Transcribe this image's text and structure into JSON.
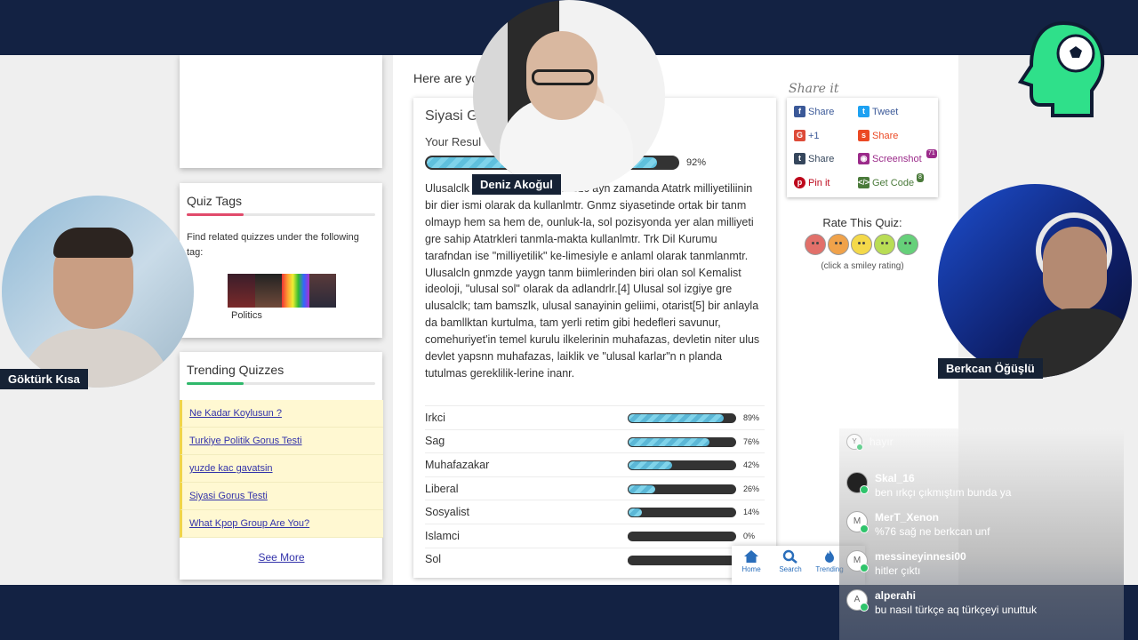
{
  "quiz_tags": {
    "title": "Quiz Tags",
    "description": "Find related quizzes under the following tag:",
    "tag_label": "Politics"
  },
  "trending": {
    "title": "Trending Quizzes",
    "items": [
      "Ne Kadar Koylusun ?",
      "Turkiye Politik Gorus Testi",
      "yuzde kac gavatsin",
      "Siyasi Gorus Testi",
      "What Kpop Group Are You?"
    ],
    "see_more": "See More"
  },
  "main": {
    "intro": "Here are yo",
    "result_title": "Siyasi G",
    "your_result_label": "Your Resul",
    "result_percent": 92,
    "result_percent_text": "92%",
    "result_text": "Ulusalclk                                   ideolojidir. Ulusalclk szc ayn zamanda Atatrk milliyetiliinin bir dier ismi olarak da kullanlmtr. Gnmz siyasetinde ortak bir tanm olmayp hem sa hem de, ounluk-la, sol pozisyonda yer alan milliyeti gre sahip Atatrkleri tanmla-makta kullanlmtr. Trk Dil Kurumu tarafndan ise \"milliyetilik\" ke-limesiyle e anlaml olarak tanmlanmtr. Ulusalcln gnmzde yaygn tanm biimlerinden biri olan sol Kemalist ideoloji, \"ulusal sol\" olarak da adlandrlr.[4] Ulusal sol izgiye gre ulusalclk; tam bamszlk, ulusal sanayinin geliimi, otarist[5] bir anlayla da bamllktan kurtulma, tam yerli retim gibi hedefleri savunur, comehuriyet'in temel kurulu ilkelerinin muhafazas, devletin niter ulus devlet yapsnn muhafazas, laiklik ve \"ulusal karlar\"n n planda tutulmas gereklilik-lerine inanr.",
    "scores": [
      {
        "label": "Irkci",
        "value": 89,
        "text": "89%"
      },
      {
        "label": "Sag",
        "value": 76,
        "text": "76%"
      },
      {
        "label": "Muhafazakar",
        "value": 42,
        "text": "42%"
      },
      {
        "label": "Liberal",
        "value": 26,
        "text": "26%"
      },
      {
        "label": "Sosyalist",
        "value": 14,
        "text": "14%"
      },
      {
        "label": "Islamci",
        "value": 0,
        "text": "0%"
      },
      {
        "label": "Sol",
        "value": 0,
        "text": ""
      }
    ]
  },
  "share": {
    "title": "Share it",
    "buttons": [
      "Share",
      "Tweet",
      "+1",
      "Share",
      "Share",
      "Screenshot",
      "Pin it",
      "Get Code"
    ],
    "screenshot_count": "71",
    "code_count": "8"
  },
  "rate": {
    "title": "Rate This Quiz:",
    "hint": "(click a smiley rating)",
    "colors": [
      "#e2706a",
      "#f0a24a",
      "#f4d94a",
      "#b9dd55",
      "#66d07a"
    ]
  },
  "mini_nav": {
    "home": "Home",
    "search": "Search",
    "trending": "Trending"
  },
  "streamers": {
    "top": "Deniz Akoğul",
    "left": "Göktürk Kısa",
    "right": "Berkcan Öğüşlü"
  },
  "chat": {
    "messages": [
      {
        "user": "",
        "text": "hayır",
        "initial": "Y"
      },
      {
        "user": "Skal_16",
        "text": "ben ırkçı çıkmıştım bunda ya",
        "initial": ""
      },
      {
        "user": "MerT_Xenon",
        "text": "%76 sağ ne berkcan unf",
        "initial": "M"
      },
      {
        "user": "messineyinnesi00",
        "text": "hitler çıktı",
        "initial": "M"
      },
      {
        "user": "alperahi",
        "text": "bu nasıl türkçe aq türkçeyi unuttuk",
        "initial": "A"
      }
    ]
  }
}
